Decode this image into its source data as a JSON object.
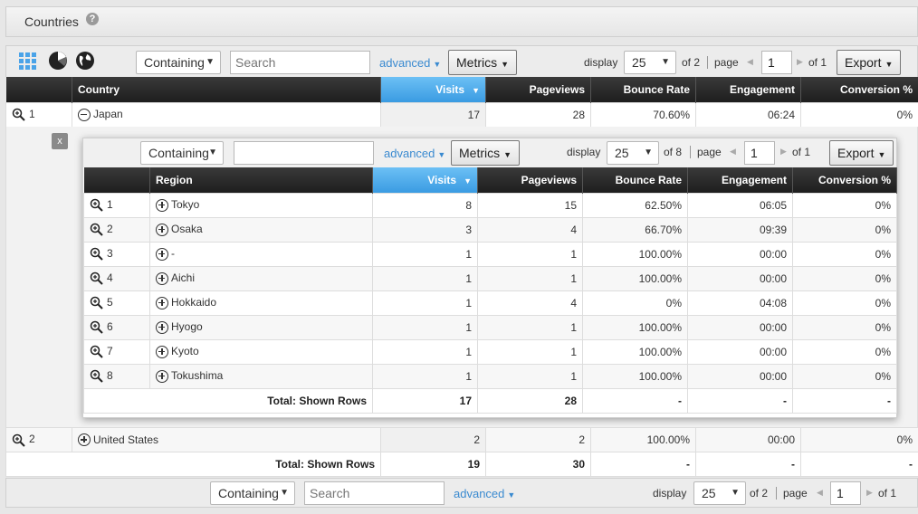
{
  "header": {
    "title": "Countries",
    "help_symbol": "?"
  },
  "icons": {
    "grid": "grid-view-icon",
    "pie": "pie-chart-icon",
    "globe": "globe-map-icon"
  },
  "toolbar": {
    "filter_mode": "Containing",
    "search_placeholder": "Search",
    "advanced_label": "advanced",
    "metrics_label": "Metrics",
    "display_label": "display",
    "display_value": "25",
    "display_of": "of 2",
    "page_label": "page",
    "page_value": "1",
    "page_of": "of 1",
    "export_label": "Export"
  },
  "columns": [
    "Country",
    "Visits",
    "Pageviews",
    "Bounce Rate",
    "Engagement",
    "Conversion %"
  ],
  "rows": [
    {
      "index": "1",
      "name": "Japan",
      "visits": "17",
      "pageviews": "28",
      "bounce_rate": "70.60%",
      "engagement": "06:24",
      "conversion": "0%"
    },
    {
      "index": "2",
      "name": "United States",
      "visits": "2",
      "pageviews": "2",
      "bounce_rate": "100.00%",
      "engagement": "00:00",
      "conversion": "0%"
    }
  ],
  "totals": {
    "label": "Total: Shown Rows",
    "visits": "19",
    "pageviews": "30",
    "bounce_rate": "-",
    "engagement": "-",
    "conversion": "-"
  },
  "subpanel": {
    "close_label": "x",
    "toolbar": {
      "filter_mode": "Containing",
      "search_placeholder": "",
      "advanced_label": "advanced",
      "metrics_label": "Metrics",
      "display_label": "display",
      "display_value": "25",
      "display_of": "of 8",
      "page_label": "page",
      "page_value": "1",
      "page_of": "of 1",
      "export_label": "Export"
    },
    "columns": [
      "Region",
      "Visits",
      "Pageviews",
      "Bounce Rate",
      "Engagement",
      "Conversion %"
    ],
    "rows": [
      {
        "index": "1",
        "name": "Tokyo",
        "visits": "8",
        "pageviews": "15",
        "bounce_rate": "62.50%",
        "engagement": "06:05",
        "conversion": "0%"
      },
      {
        "index": "2",
        "name": "Osaka",
        "visits": "3",
        "pageviews": "4",
        "bounce_rate": "66.70%",
        "engagement": "09:39",
        "conversion": "0%"
      },
      {
        "index": "3",
        "name": "-",
        "visits": "1",
        "pageviews": "1",
        "bounce_rate": "100.00%",
        "engagement": "00:00",
        "conversion": "0%"
      },
      {
        "index": "4",
        "name": "Aichi",
        "visits": "1",
        "pageviews": "1",
        "bounce_rate": "100.00%",
        "engagement": "00:00",
        "conversion": "0%"
      },
      {
        "index": "5",
        "name": "Hokkaido",
        "visits": "1",
        "pageviews": "4",
        "bounce_rate": "0%",
        "engagement": "04:08",
        "conversion": "0%"
      },
      {
        "index": "6",
        "name": "Hyogo",
        "visits": "1",
        "pageviews": "1",
        "bounce_rate": "100.00%",
        "engagement": "00:00",
        "conversion": "0%"
      },
      {
        "index": "7",
        "name": "Kyoto",
        "visits": "1",
        "pageviews": "1",
        "bounce_rate": "100.00%",
        "engagement": "00:00",
        "conversion": "0%"
      },
      {
        "index": "8",
        "name": "Tokushima",
        "visits": "1",
        "pageviews": "1",
        "bounce_rate": "100.00%",
        "engagement": "00:00",
        "conversion": "0%"
      }
    ],
    "totals": {
      "label": "Total: Shown Rows",
      "visits": "17",
      "pageviews": "28",
      "bounce_rate": "-",
      "engagement": "-",
      "conversion": "-"
    }
  },
  "bottombar": {
    "filter_mode": "Containing",
    "search_placeholder": "Search",
    "advanced_label": "advanced",
    "display_label": "display",
    "display_value": "25",
    "display_of": "of 2",
    "page_label": "page",
    "page_value": "1",
    "page_of": "of 1"
  },
  "colors": {
    "accent": "#3a9be2",
    "header_dark": "#262626",
    "link": "#3a8ad0"
  }
}
